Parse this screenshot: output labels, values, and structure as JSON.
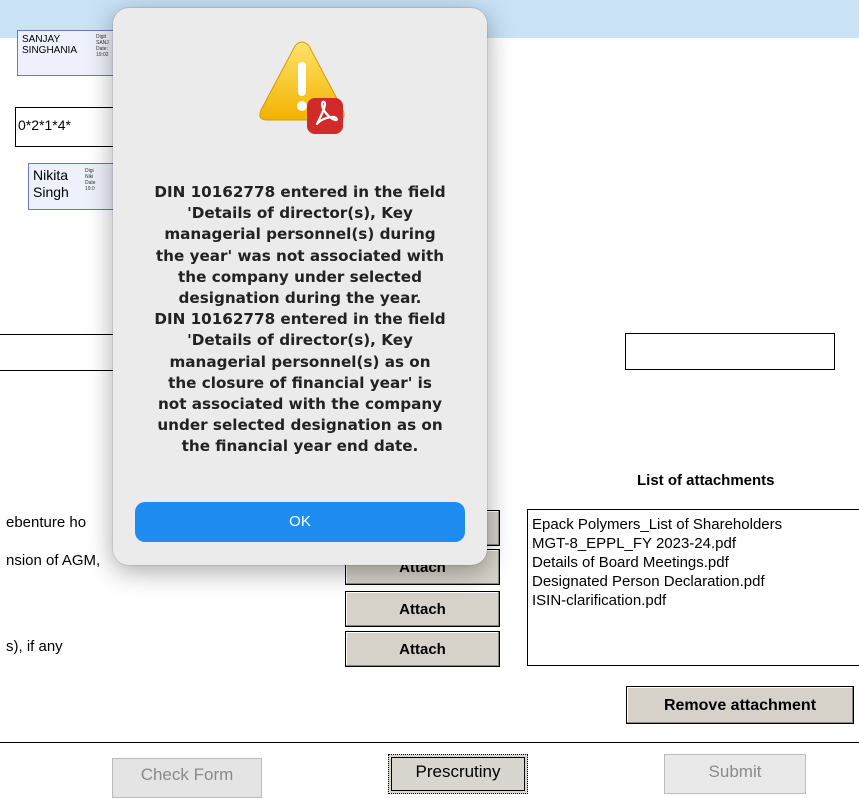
{
  "signature_top": {
    "name": "SANJAY\nSINGHANIA",
    "meta": "Digit\nSANJ\nDate:\n19:02"
  },
  "signature_mid": {
    "name": "Nikita\nSingh",
    "meta": "Digi\nNiki\nDate\n19:0"
  },
  "pan_field": {
    "value": "0*2*1*4*"
  },
  "labels": {
    "debenture": "ebenture ho",
    "agm": "nsion of AGM,",
    "if_any": "s), if any"
  },
  "attachments": {
    "title": "List of attachments",
    "items": [
      "Epack Polymers_List of Shareholders",
      "MGT-8_EPPL_FY 2023-24.pdf",
      "Details of Board Meetings.pdf",
      "Designated Person Declaration.pdf",
      "ISIN-clarification.pdf"
    ],
    "attach_label": "Attach",
    "remove_label": "Remove attachment"
  },
  "bottom_buttons": {
    "check_form": "Check Form",
    "prescrutiny": "Prescrutiny",
    "submit": "Submit"
  },
  "dialog": {
    "icon": "warning-acrobat-icon",
    "message": "DIN 10162778 entered in the field\n'Details of director(s), Key\nmanagerial personnel(s) during\nthe year' was not associated with\nthe company under selected\ndesignation during the year.\nDIN 10162778 entered in the field\n'Details of director(s), Key\nmanagerial personnel(s) as on\nthe closure of financial year' is\nnot associated with the company\nunder selected designation as on\nthe financial year end date.",
    "ok_label": "OK"
  },
  "colors": {
    "accent": "#1f8cf2",
    "topbar": "#c9e2f6",
    "button_face": "#d6d2c9"
  }
}
